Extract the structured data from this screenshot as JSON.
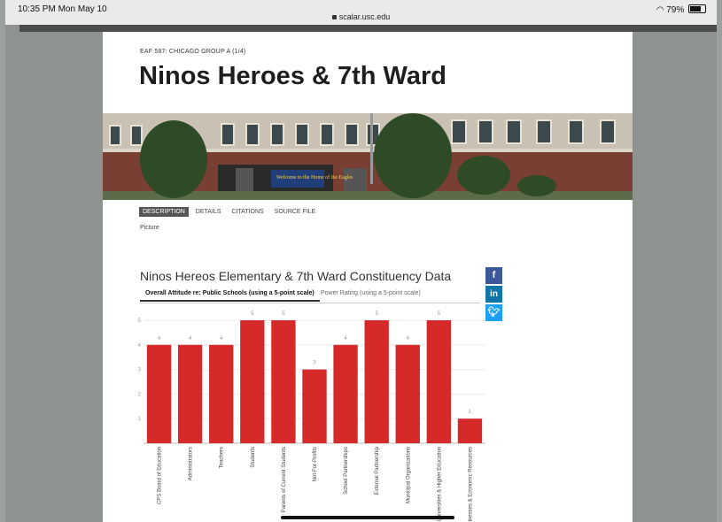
{
  "status": {
    "time": "10:35 PM  Mon May 10",
    "url": "scalar.usc.edu",
    "battery": "79%"
  },
  "page": {
    "breadcrumb": "EAF 587: CHICAGO GROUP A (1/4)",
    "title": "Ninos Heroes & 7th Ward",
    "hero_caption": "Welcome to the Home of the Eagles",
    "tabs": [
      "DESCRIPTION",
      "DETAILS",
      "CITATIONS",
      "SOURCE FILE"
    ],
    "picture_label": "Picture"
  },
  "share": {
    "facebook": "f",
    "linkedin": "in",
    "twitter": "t"
  },
  "chart_tabs": {
    "active": "Overall Attitude re: Public Schools (using a 5-point scale)",
    "inactive": "Power Rating (using a 5-point scale)"
  },
  "chart_data": {
    "type": "bar",
    "title": "Ninos Hereos Elementary & 7th Ward Constituency Data",
    "categories": [
      "CPS Board of Education",
      "Administrators",
      "Teachers",
      "Students",
      "Parents of Current Students",
      "Not-For-Profits",
      "School Partnerships",
      "External Partnership",
      "Municipal Organizations",
      "Universities & Higher Education",
      "Businesses & Economic Resources"
    ],
    "values": [
      4,
      4,
      4,
      5,
      5,
      3,
      4,
      5,
      4,
      5,
      1
    ],
    "ylim": [
      0,
      5
    ],
    "yticks": [
      1,
      2,
      3,
      4,
      5
    ],
    "grid": true,
    "color": "#d62a2a"
  }
}
